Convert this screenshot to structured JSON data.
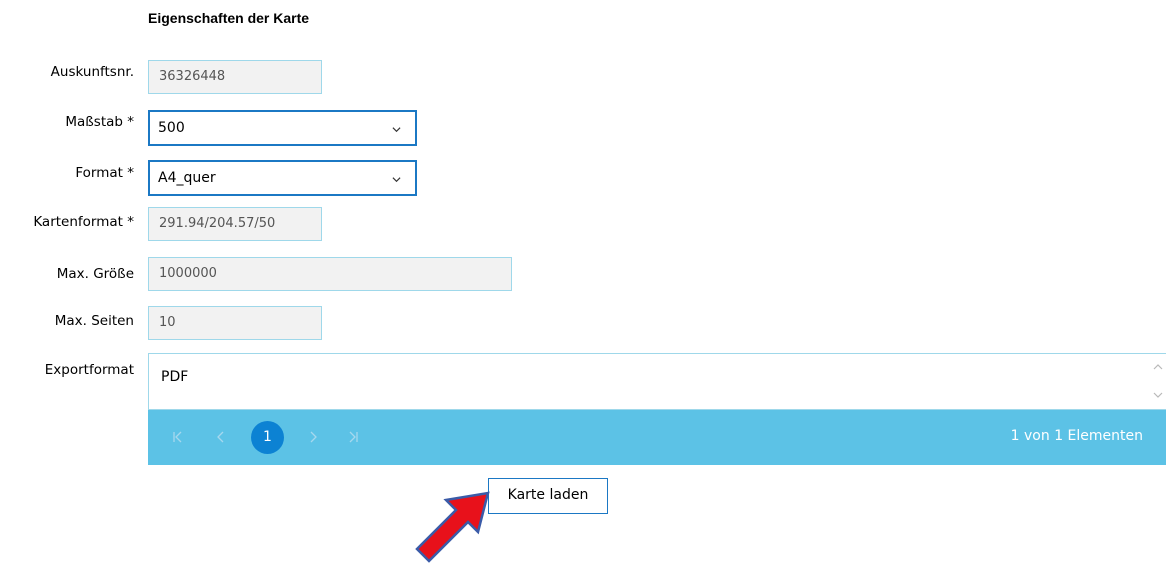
{
  "section": {
    "title": "Eigenschaften der Karte"
  },
  "fields": {
    "auskunftsnr": {
      "label": "Auskunftsnr.",
      "value": "36326448"
    },
    "massstab": {
      "label": "Maßstab *",
      "value": "500"
    },
    "format": {
      "label": "Format *",
      "value": "A4_quer"
    },
    "kartenformat": {
      "label": "Kartenformat *",
      "value": "291.94/204.57/50"
    },
    "max_groesse": {
      "label": "Max. Größe",
      "value": "1000000"
    },
    "max_seiten": {
      "label": "Max. Seiten",
      "value": "10"
    }
  },
  "exportformat": {
    "label": "Exportformat",
    "items": [
      "PDF"
    ]
  },
  "pager": {
    "current_page": "1",
    "info": "1 von 1 Elementen"
  },
  "load_button": {
    "label": "Karte laden"
  },
  "icons": {
    "chevron": "chevron-down-icon",
    "first": "first-page-icon",
    "prev": "previous-page-icon",
    "next": "next-page-icon",
    "last": "last-page-icon",
    "scroll_up": "scroll-up-icon",
    "scroll_down": "scroll-down-icon",
    "arrow": "red-arrow-annotation"
  },
  "colors": {
    "accent": "#1b78c4",
    "pager_bg": "#5cc2e6",
    "page_active": "#0c82d3",
    "readonly_bg": "#f2f2f2",
    "arrow": "#e8111b"
  }
}
